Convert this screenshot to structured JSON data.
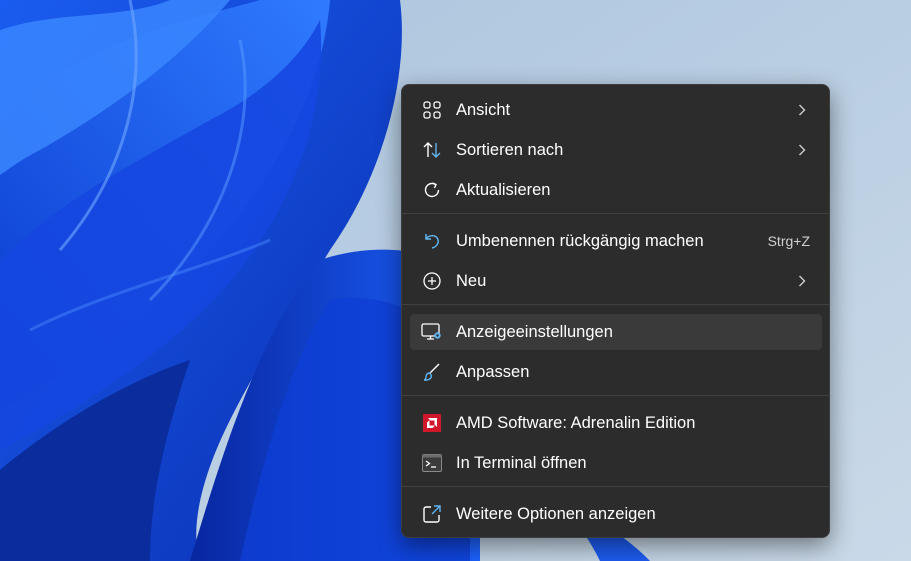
{
  "menu": {
    "items": [
      {
        "label": "Ansicht",
        "icon": "grid-view-icon",
        "submenu": true
      },
      {
        "label": "Sortieren nach",
        "icon": "sort-arrows-icon",
        "submenu": true
      },
      {
        "label": "Aktualisieren",
        "icon": "refresh-icon"
      },
      {
        "label": "Umbenennen rückgängig machen",
        "icon": "undo-icon",
        "shortcut": "Strg+Z"
      },
      {
        "label": "Neu",
        "icon": "add-circle-icon",
        "submenu": true
      },
      {
        "label": "Anzeigeeinstellungen",
        "icon": "display-settings-icon",
        "highlighted": true
      },
      {
        "label": "Anpassen",
        "icon": "paintbrush-icon"
      },
      {
        "label": "AMD Software: Adrenalin Edition",
        "icon": "amd-logo-icon"
      },
      {
        "label": "In Terminal öffnen",
        "icon": "terminal-icon"
      },
      {
        "label": "Weitere Optionen anzeigen",
        "icon": "open-external-icon"
      }
    ]
  },
  "colors": {
    "menu_background": "#2c2c2c",
    "hover_background": "#3a3a3a",
    "accent": "#60b4f0",
    "amd_red": "#d0182a",
    "text": "#ffffff"
  }
}
